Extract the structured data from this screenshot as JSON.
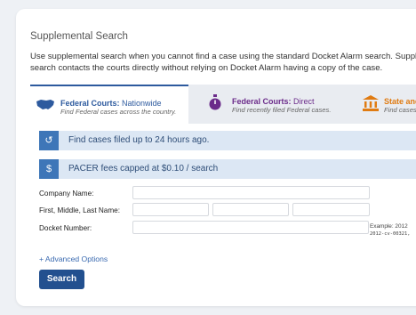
{
  "section": {
    "title": "Supplemental Search",
    "description_line1": "Use supplemental search when you cannot find a case using the standard Docket Alarm search. Supplemental",
    "description_line2": "search contacts the courts directly without relying on Docket Alarm having a copy of the case."
  },
  "tabs": [
    {
      "label_bold": "Federal Courts:",
      "label_rest": " Nationwide",
      "sub": "Find Federal cases across the country.",
      "icon": "usa-map-icon",
      "color": "#2d5a9e"
    },
    {
      "label_bold": "Federal Courts:",
      "label_rest": " Direct",
      "sub": "Find recently filed Federal cases.",
      "icon": "stopwatch-icon",
      "color": "#6b2b8a"
    },
    {
      "label_bold": "State and",
      "label_rest": "",
      "sub": "Find cases a",
      "icon": "courthouse-icon",
      "color": "#e07b12"
    }
  ],
  "info": [
    {
      "icon": "refresh-icon",
      "glyph": "↺",
      "text": "Find cases filed up to 24 hours ago."
    },
    {
      "icon": "dollar-icon",
      "glyph": "$",
      "text": "PACER fees capped at $0.10 / search"
    }
  ],
  "form": {
    "company_label": "Company Name:",
    "name_label": "First, Middle, Last Name:",
    "docket_label": "Docket Number:",
    "example_label": "Example: 2012",
    "example_value": "2012-cv-00321,"
  },
  "advanced_options": "+ Advanced Options",
  "search_button": "Search"
}
